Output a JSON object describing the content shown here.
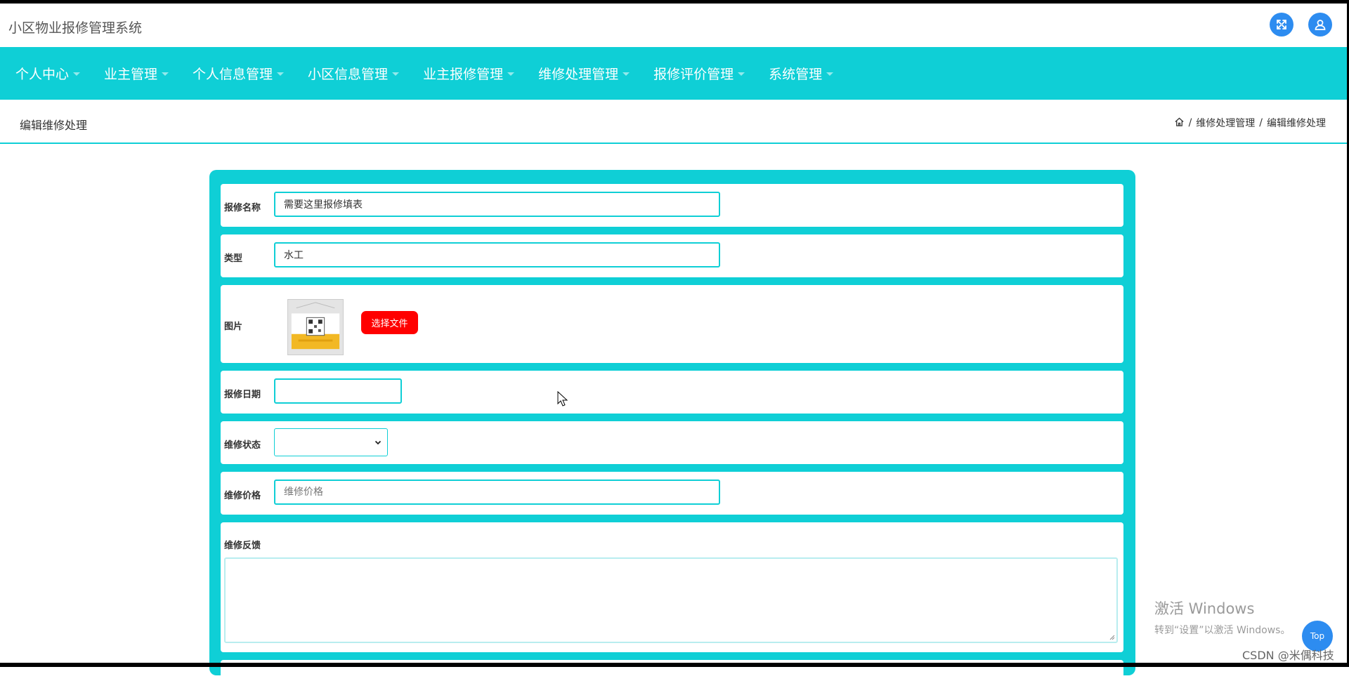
{
  "header": {
    "app_title": "小区物业报修管理系统",
    "icons": [
      "fullscreen-icon",
      "user-icon"
    ],
    "accent_color": "#2d8cf0"
  },
  "nav": {
    "bg_color": "#0fcfd6",
    "items": [
      {
        "label": "个人中心"
      },
      {
        "label": "业主管理"
      },
      {
        "label": "个人信息管理"
      },
      {
        "label": "小区信息管理"
      },
      {
        "label": "业主报修管理"
      },
      {
        "label": "维修处理管理"
      },
      {
        "label": "报修评价管理"
      },
      {
        "label": "系统管理"
      }
    ]
  },
  "page": {
    "title": "编辑维修处理",
    "breadcrumb": [
      "home-icon",
      "维修处理管理",
      "编辑维修处理"
    ]
  },
  "form": {
    "repair_name": {
      "label": "报修名称",
      "value": "需要这里报修填表"
    },
    "type": {
      "label": "类型",
      "value": "水工"
    },
    "image": {
      "label": "图片",
      "button_label": "选择文件",
      "button_color": "#ff0000"
    },
    "repair_date": {
      "label": "报修日期",
      "value": ""
    },
    "repair_status": {
      "label": "维修状态",
      "value": ""
    },
    "repair_price": {
      "label": "维修价格",
      "placeholder": "维修价格"
    },
    "feedback": {
      "label": "维修反馈",
      "value": ""
    }
  },
  "watermark": {
    "title": "激活 Windows",
    "subtitle": "转到“设置”以激活 Windows。",
    "csdn": "CSDN @米偶科技"
  },
  "top_button": {
    "label": "Top"
  }
}
